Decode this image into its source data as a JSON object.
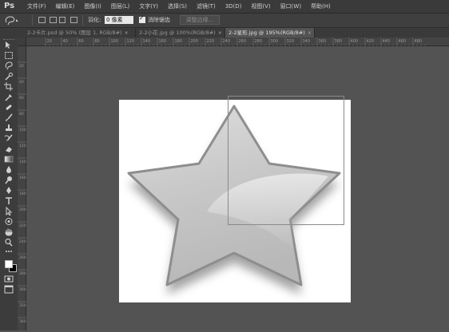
{
  "app": {
    "logo": "Ps"
  },
  "menu": {
    "items": [
      "文件(F)",
      "编辑(E)",
      "图像(I)",
      "图层(L)",
      "文字(Y)",
      "选择(S)",
      "滤镜(T)",
      "3D(D)",
      "视图(V)",
      "窗口(W)",
      "帮助(H)"
    ]
  },
  "options": {
    "feather_label": "羽化:",
    "feather_value": "0 像素",
    "antialias_label": "消除锯齿",
    "antialias_checked": true,
    "refine_edge_label": "调整边缘..."
  },
  "tabs": [
    {
      "label": "2-2卡片.psd @ 50% (图层 1, RGB/8#)",
      "active": false
    },
    {
      "label": "2-2小花.jpg @ 100%(RGB/8#)",
      "active": false
    },
    {
      "label": "2-2星形.jpg @ 195%(RGB/8#)",
      "active": true
    }
  ],
  "tab_close_glyph": "×",
  "ruler": {
    "top_ticks": [
      "20",
      "40",
      "60",
      "80",
      "100",
      "120",
      "140",
      "160",
      "180",
      "200",
      "220",
      "240",
      "260",
      "280",
      "300",
      "320",
      "340",
      "360",
      "380",
      "400",
      "420",
      "440",
      "460",
      "480"
    ],
    "left_ticks": [
      "20",
      "40",
      "60",
      "80",
      "100",
      "120",
      "140",
      "160",
      "180",
      "200",
      "220",
      "240",
      "260",
      "280",
      "300",
      "320",
      "340",
      "360"
    ]
  },
  "tools": [
    "move-icon",
    "marquee-icon",
    "lasso-icon",
    "quick-select-icon",
    "crop-icon",
    "eyedropper-icon",
    "healing-brush-icon",
    "brush-icon",
    "clone-stamp-icon",
    "history-brush-icon",
    "eraser-icon",
    "gradient-icon",
    "blur-icon",
    "dodge-icon",
    "pen-icon",
    "type-icon",
    "path-select-icon",
    "shape-icon",
    "hand-icon",
    "zoom-icon"
  ],
  "colors": {
    "foreground": "#ffffff",
    "background": "#000000",
    "star_fill": "#c4c4c4",
    "star_edge": "#8e8e8e"
  }
}
